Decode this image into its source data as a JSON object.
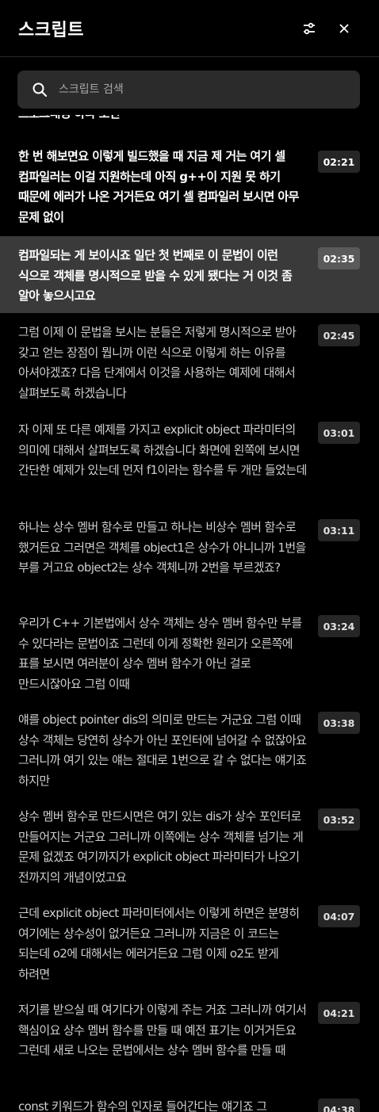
{
  "header": {
    "title": "스크립트"
  },
  "search": {
    "placeholder": "스크립트 검색"
  },
  "partial_top": "프로그래밍 하다 보면",
  "items": [
    {
      "time": "02:21",
      "text": "한 번 해보면요 이렇게 빌드했을 때 지금 제 거는 여기 셀 컴파일러는 이걸 지원하는데 아직 g++이 지원 못 하기 때문에 에러가 나온 거거든요 여기 셀 컴파일러 보시면 아무 문제 없이"
    },
    {
      "time": "02:35",
      "text": "컴파일되는 게 보이시죠 일단 첫 번째로 이 문법이 이런 식으로 객체를 명시적으로 받을 수 있게 됐다는 거 이것 좀 알아 놓으시고요"
    },
    {
      "time": "02:45",
      "text": "그럼 이제 이 문법을 보시는 분들은 저렇게 명시적으로 받아 갖고 얻는 장점이 뭡니까 이런 식으로 이렇게 하는 이유를 아셔야겠죠? 다음 단계에서 이것을 사용하는 예제에 대해서 살펴보도록 하겠습니다"
    },
    {
      "time": "03:01",
      "text": "자 이제 또 다른 예제를 가지고 explicit object 파라미터의 의미에 대해서 살펴보도록 하겠습니다 화면에 왼쪽에 보시면 간단한 예제가 있는데 먼저 f1이라는 함수를 두 개만 들었는데"
    },
    {
      "time": "03:11",
      "text": "하나는 상수 멤버 함수로 만들고 하나는 비상수 멤버 함수로 했거든요 그러면은 객체를 object1은 상수가 아니니까 1번을 부를 거고요 object2는 상수 객체니까 2번을 부르겠죠?"
    },
    {
      "time": "03:24",
      "text": "우리가 C++ 기본법에서 상수 객체는 상수 멤버 함수만 부를 수 있다라는 문법이죠 그런데 이게 정확한 원리가 오른쪽에 표를 보시면 여러분이 상수 멤버 함수가 아닌 걸로 만드시잖아요 그럼 이때"
    },
    {
      "time": "03:38",
      "text": "얘를 object pointer dis의 의미로 만드는 거군요 그럼 이때 상수 객체는 당연히 상수가 아닌 포인터에 넘어갈 수 없잖아요 그러니까 여기 있는 얘는 절대로 1번으로 갈 수 없다는 얘기죠 하지만"
    },
    {
      "time": "03:52",
      "text": "상수 멤버 함수로 만드시면은 여기 있는 dis가 상수 포인터로 만들어지는 거군요 그러니까 이쪽에는 상수 객체를 넘기는 게 문제 없겠죠 여기까지가 explicit object 파라미터가 나오기 전까지의 개념이었고요"
    },
    {
      "time": "04:07",
      "text": "근데 explicit object 파라미터에서는 이렇게 하면은 분명히 여기에는 상수성이 없거든요 그러니까 지금은 이 코드는 되는데 o2에 대해서는 에러거든요 그럼 이제 o2도 받게 하려면"
    },
    {
      "time": "04:21",
      "text": "저기를 받으실 때 여기다가 이렇게 주는 거죠 그러니까 여기서 핵심이요 상수 멤버 함수를 만들 때 예전 표기는 이거거든요 그런데 새로 나오는 문법에서는 상수 멤버 함수를 만들 때"
    },
    {
      "time": "04:38",
      "text": "const 키워드가 함수의 인자로 들어간다는 얘기죠 그"
    }
  ]
}
